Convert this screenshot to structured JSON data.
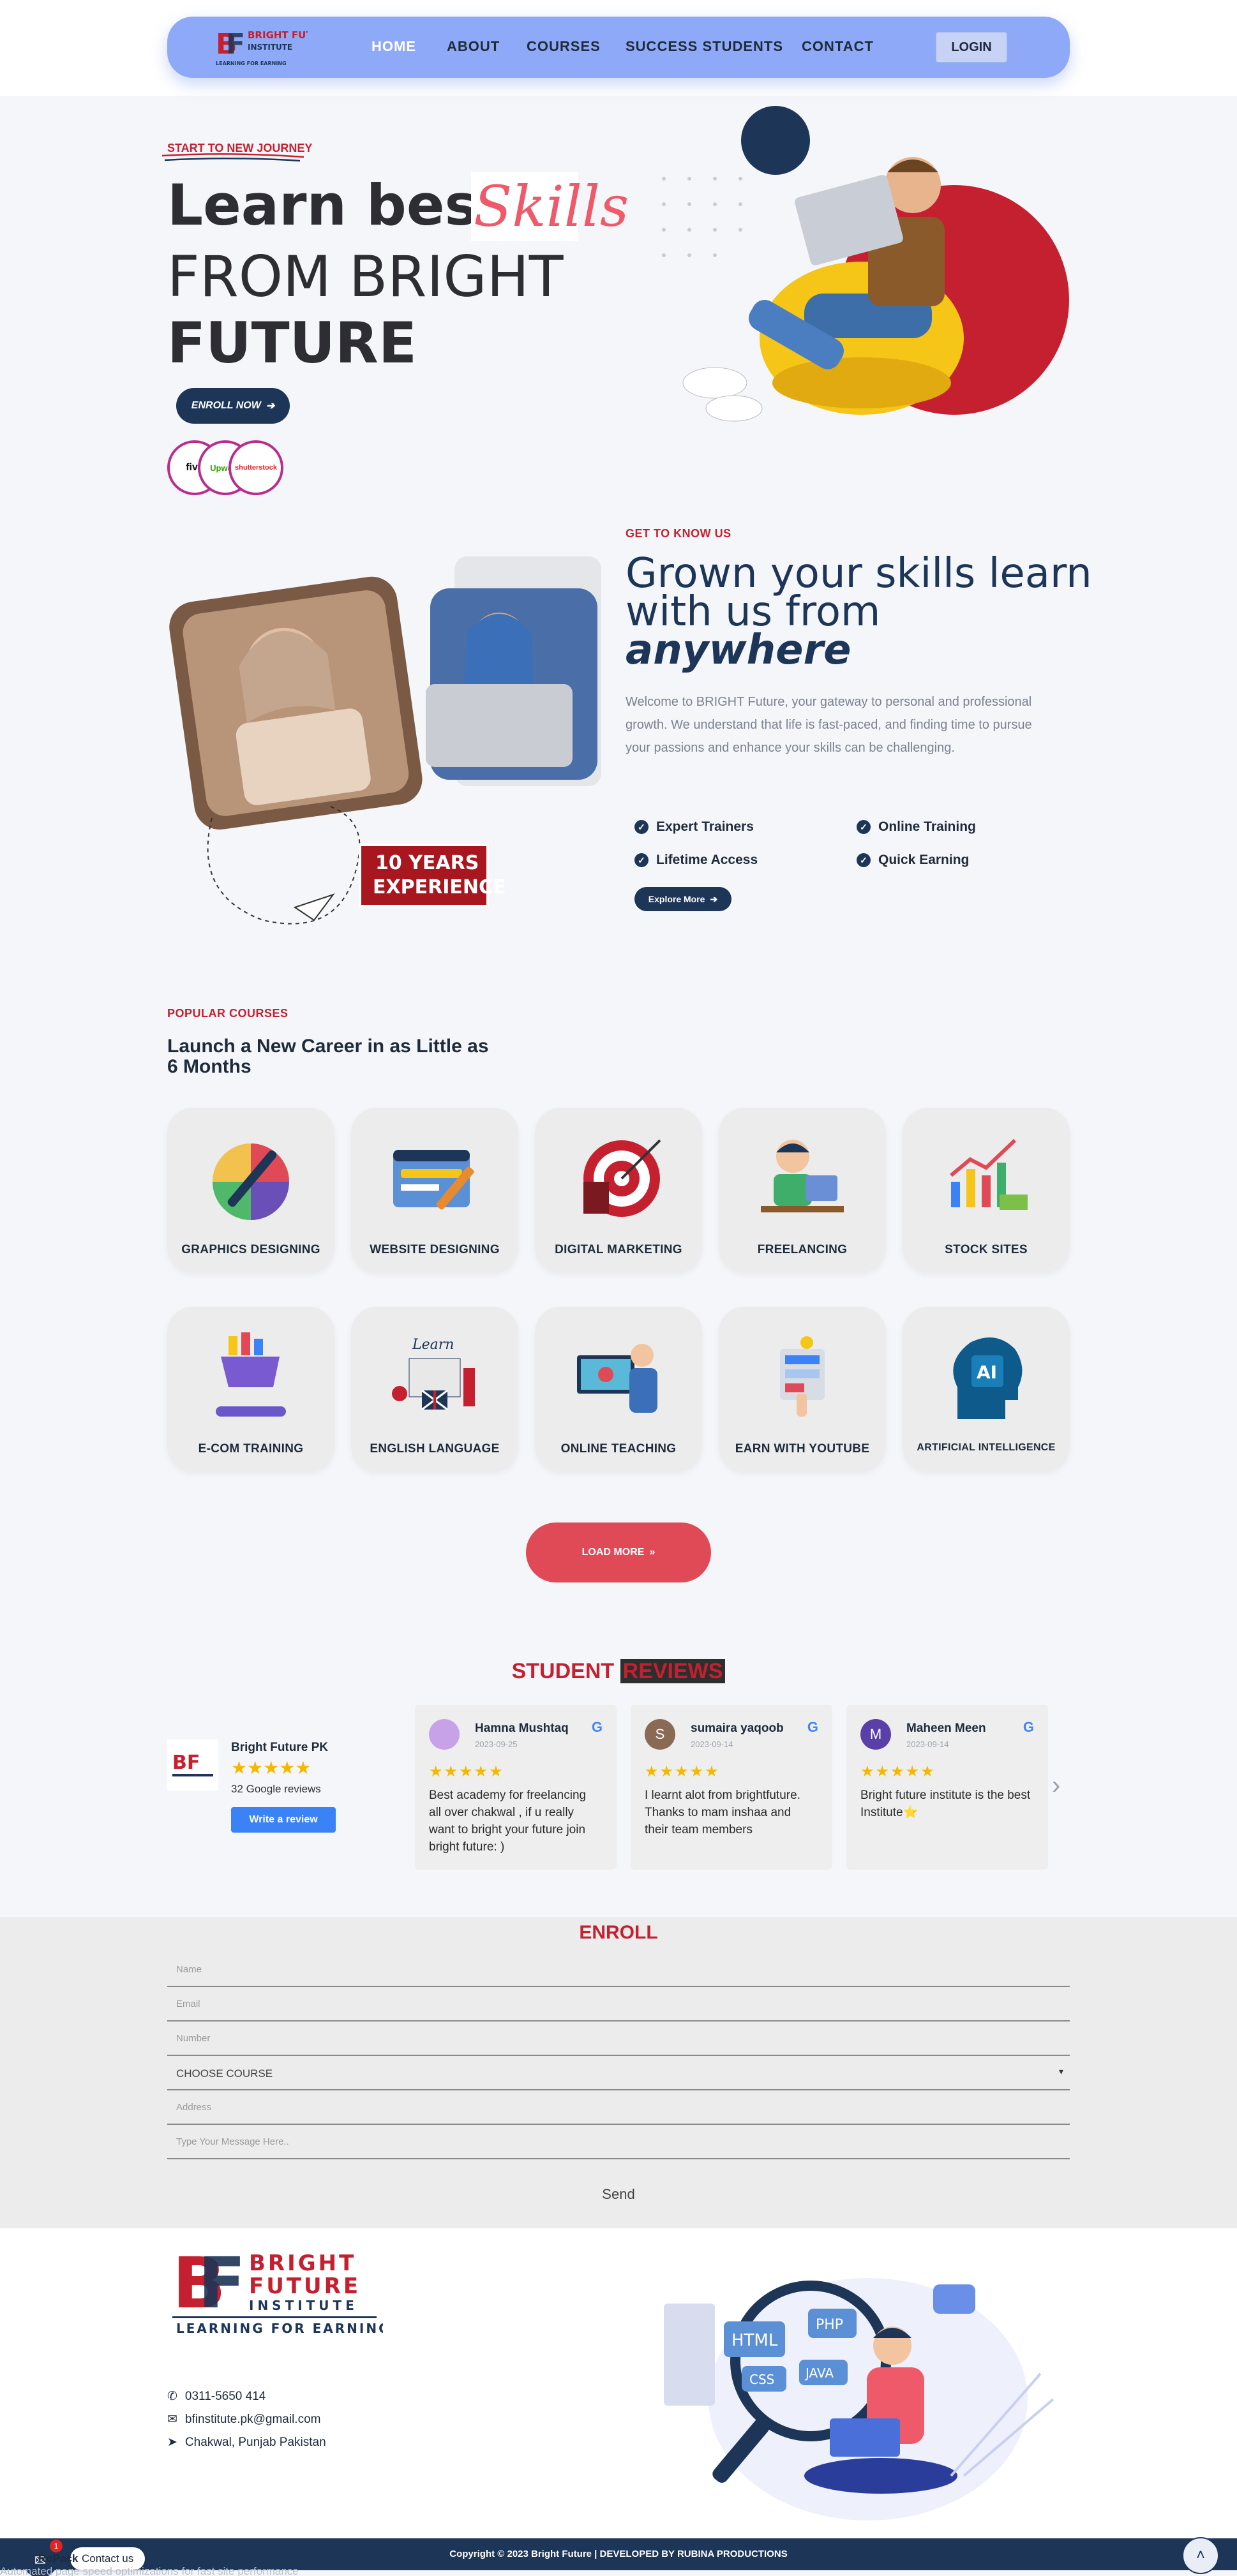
{
  "header": {
    "logo_brand": "BRIGHT FUTURE",
    "logo_sub": "INSTITUTE",
    "logo_tagline": "LEARNING FOR EARNING",
    "nav": [
      "HOME",
      "ABOUT",
      "COURSES",
      "SUCCESS STUDENTS",
      "CONTACT"
    ],
    "login": "LOGIN"
  },
  "hero": {
    "tag": "START TO NEW JOURNEY",
    "line1": "Learn best",
    "skills": "Skills",
    "line2": "FROM BRIGHT",
    "line3": "FUTURE",
    "enroll": "ENROLL NOW",
    "partners": [
      "five",
      "Upwork",
      "shutterstock"
    ]
  },
  "about": {
    "tag": "GET TO KNOW US",
    "title1": "Grown your skills learn",
    "title2": "with us from",
    "title3": "anywhere",
    "description": "Welcome to BRIGHT Future, your gateway to personal and professional growth. We understand that life is fast-paced, and finding time to pursue your passions and enhance your skills can be challenging.",
    "features": [
      "Expert Trainers",
      "Online Training",
      "Lifetime Access",
      "Quick Earning"
    ],
    "explore": "Explore More",
    "badge_line1": "10 YEARS",
    "badge_line2": "EXPERIENCE"
  },
  "courses": {
    "tag": "POPULAR COURSES",
    "title": "Launch a New Career in as Little as 6 Months",
    "items": [
      "GRAPHICS DESIGNING",
      "WEBSITE DESIGNING",
      "DIGITAL MARKETING",
      "FREELANCING",
      "STOCK SITES",
      "E-COM TRAINING",
      "ENGLISH LANGUAGE",
      "ONLINE TEACHING",
      "EARN WITH YOUTUBE",
      "ARTIFICIAL INTELLIGENCE"
    ],
    "load_more": "LOAD MORE"
  },
  "reviews": {
    "title_a": "STUDENT ",
    "title_b": "REVIEWS",
    "business_name": "Bright Future PK",
    "google_count": "32 Google reviews",
    "write_review": "Write a review",
    "stars": "★★★★★",
    "items": [
      {
        "name": "Hamna Mushtaq",
        "date": "2023-09-25",
        "initial": "",
        "color": "#c8a2e8",
        "text": "Best academy for freelancing all over chakwal , if u really want to bright your future join bright future: )"
      },
      {
        "name": "sumaira yaqoob",
        "date": "2023-09-14",
        "initial": "S",
        "color": "#8a6a55",
        "text": "I learnt alot from brightfuture. Thanks to mam inshaa and their team members"
      },
      {
        "name": "Maheen Meen",
        "date": "2023-09-14",
        "initial": "M",
        "color": "#5b3fa8",
        "text": "Bright future institute is the best Institute⭐"
      }
    ]
  },
  "enroll": {
    "title": "ENROLL",
    "name_ph": "Name",
    "email_ph": "Email",
    "number_ph": "Number",
    "course": "CHOOSE COURSE",
    "address_ph": "Address",
    "message_ph": "Type Your Message Here..",
    "send": "Send"
  },
  "footer": {
    "phone": "0311-5650 414",
    "email": "bfinstitute.pk@gmail.com",
    "address": "Chakwal, Punjab Pakistan",
    "illus_tags": [
      "HTML",
      "PHP",
      "CSS",
      "JAVA"
    ],
    "copyright": "Copyright © 2023 Bright Future | DEVELOPED BY RUBINA PRODUCTIONS",
    "contact_us": "Contact us",
    "chat_badge": "1",
    "speed_note": "Automated page speed optimizations for fast site performance",
    "rocket": "RoPack"
  },
  "colors": {
    "navy": "#1d3557",
    "red": "#c5202f",
    "nav_bg": "#8ea9f7",
    "accent_pink": "#ee5a6a"
  }
}
